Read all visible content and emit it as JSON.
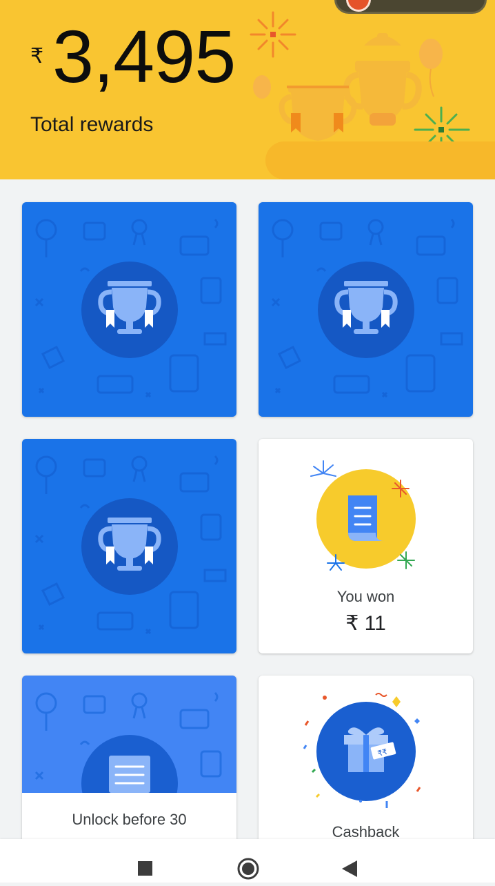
{
  "header": {
    "currency_symbol": "₹",
    "total_amount": "3,495",
    "total_label": "Total rewards",
    "background_color": "#f9c531"
  },
  "cards": [
    {
      "type": "scratch-card",
      "icon": "trophy-icon",
      "state": "unscratched"
    },
    {
      "type": "scratch-card",
      "icon": "trophy-icon",
      "state": "unscratched"
    },
    {
      "type": "scratch-card",
      "icon": "trophy-icon",
      "state": "unscratched"
    },
    {
      "type": "reward-won",
      "icon": "receipt-icon",
      "label": "You won",
      "amount": "₹ 11"
    },
    {
      "type": "locked-reward",
      "icon": "receipt-icon",
      "label": "Unlock before 30"
    },
    {
      "type": "cashback",
      "icon": "gift-icon",
      "label": "Cashback"
    }
  ],
  "colors": {
    "card_blue": "#1a73e8",
    "card_light_blue": "#4285f4",
    "accent_yellow": "#f9c531"
  },
  "navbar": {
    "items": [
      "recent-apps-icon",
      "home-icon",
      "back-icon"
    ]
  }
}
